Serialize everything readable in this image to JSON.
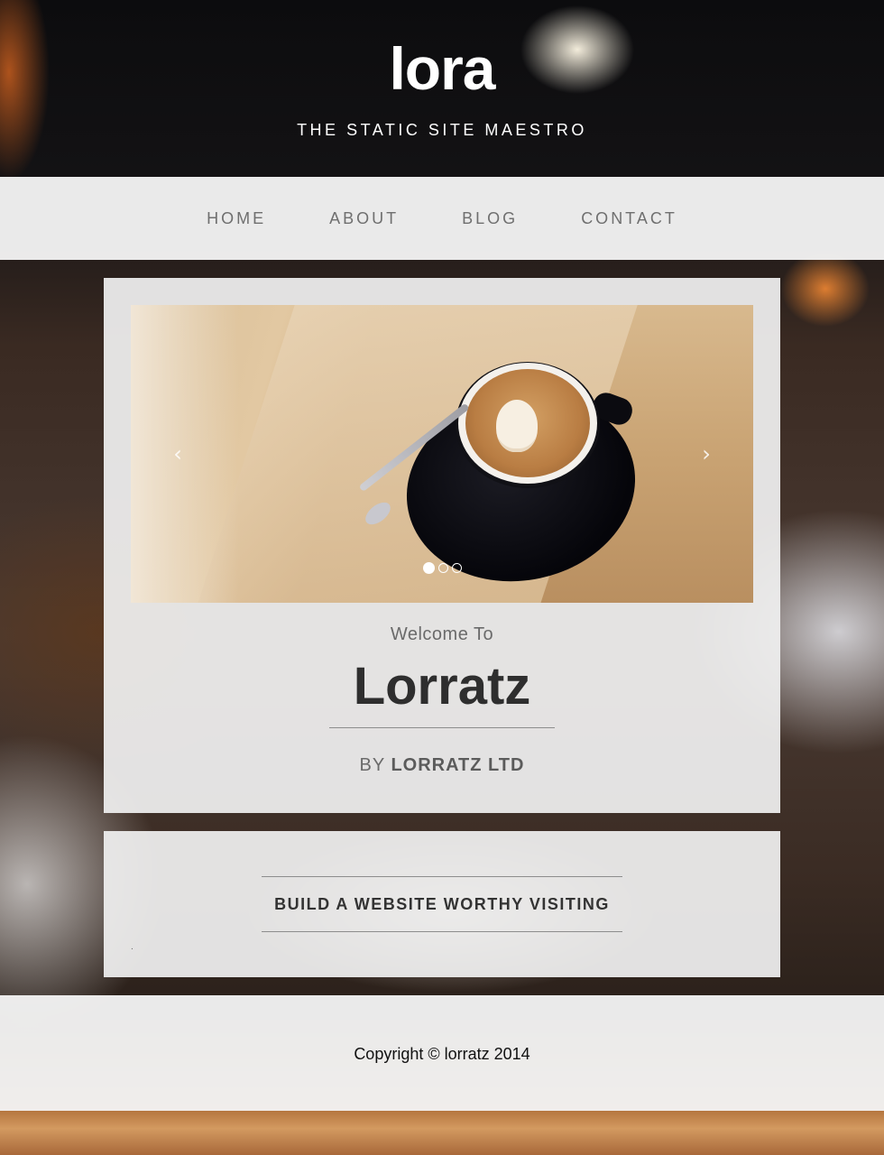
{
  "site": {
    "title": "lora",
    "tagline": "THE STATIC SITE MAESTRO"
  },
  "nav": {
    "items": [
      {
        "label": "HOME"
      },
      {
        "label": "ABOUT"
      },
      {
        "label": "BLOG"
      },
      {
        "label": "CONTACT"
      }
    ]
  },
  "hero": {
    "slider": {
      "prev_icon": "chevron-left-icon",
      "next_icon": "chevron-right-icon",
      "prev_glyph": "‹",
      "next_glyph": "›",
      "slide_count": 3,
      "active_slide": 1
    },
    "welcome": "Welcome To",
    "brand": "Lorratz",
    "byline_prefix": "BY",
    "byline_company": "LORRATZ LTD"
  },
  "cta": {
    "heading": "BUILD A WEBSITE WORTHY VISITING",
    "dot": "."
  },
  "footer": {
    "copyright": "Copyright © lorratz 2014"
  },
  "colors": {
    "nav_text": "#6f6f6f",
    "heading_text": "#2e2e2e",
    "card_bg": "#f0f0f0"
  }
}
